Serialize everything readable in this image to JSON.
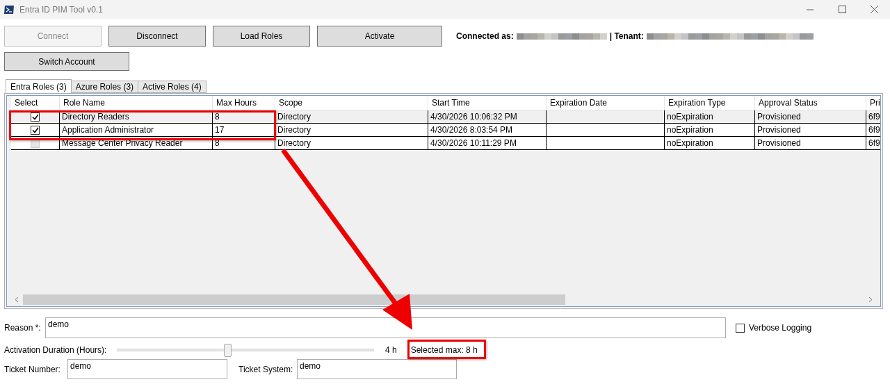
{
  "window": {
    "title": "Entra ID PIM Tool v0.1"
  },
  "toolbar": {
    "buttons": [
      {
        "label": "Connect",
        "disabled": true
      },
      {
        "label": "Disconnect",
        "disabled": false
      },
      {
        "label": "Load Roles",
        "disabled": false
      },
      {
        "label": "Activate",
        "disabled": false
      }
    ],
    "second_row": [
      {
        "label": "Switch Account",
        "disabled": false
      }
    ]
  },
  "connection": {
    "user_label": "Connected as:",
    "tenant_label": "| Tenant:"
  },
  "tabs": [
    {
      "label": "Entra Roles (3)",
      "selected": true
    },
    {
      "label": "Azure Roles (3)",
      "selected": false
    },
    {
      "label": "Active Roles (4)",
      "selected": false
    }
  ],
  "table": {
    "select_column": "Select",
    "columns": [
      "Role Name",
      "Max Hours",
      "Scope",
      "Start Time",
      "Expiration Date",
      "Expiration Type",
      "Approval Status",
      "Pri"
    ],
    "rows": [
      {
        "selected": true,
        "checked": true,
        "disabled": false,
        "cells": [
          "Directory Readers",
          "8",
          "Directory",
          "4/30/2026 10:06:32 PM",
          "",
          "noExpiration",
          "Provisioned",
          "6f9"
        ]
      },
      {
        "selected": false,
        "checked": true,
        "disabled": false,
        "cells": [
          "Application Administrator",
          "17",
          "Directory",
          "4/30/2026 8:03:54 PM",
          "",
          "noExpiration",
          "Provisioned",
          "6f9"
        ]
      },
      {
        "selected": false,
        "checked": false,
        "disabled": true,
        "cells": [
          "Message Center Privacy Reader",
          "8",
          "Directory",
          "4/30/2026 10:11:29 PM",
          "",
          "noExpiration",
          "Provisioned",
          "6f9"
        ]
      }
    ]
  },
  "form": {
    "reason": {
      "label": "Reason *:",
      "value": "demo"
    },
    "verbose": {
      "label": "Verbose Logging",
      "checked": false
    },
    "duration": {
      "label": "Activation Duration (Hours):",
      "level": 0.43,
      "reading": "4 h",
      "selected_max": "Selected max: 8 h"
    },
    "ticket_number": {
      "label": "Ticket Number:",
      "value": "demo"
    },
    "ticket_system": {
      "label": "Ticket System:",
      "value": "demo"
    }
  }
}
